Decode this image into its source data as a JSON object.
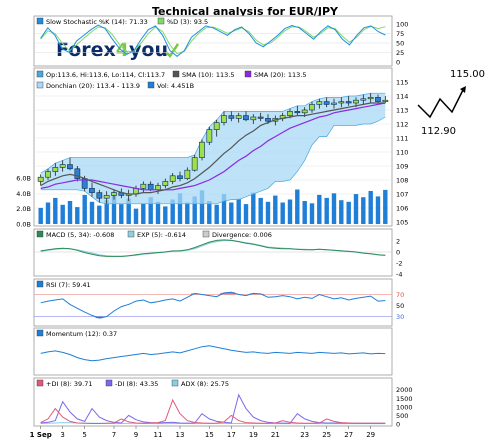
{
  "title": "Technical analysis for EUR/JPY",
  "logo": {
    "text_a": "Forex",
    "digit": "4",
    "text_b": "you"
  },
  "colors": {
    "candle_up": "#2f7fd0",
    "candle_down": "#0b2b55",
    "candle_body_up": "#9fe04a",
    "sma10": "#555555",
    "sma20": "#8a2be2",
    "donchian_fill": "#a8d8f5",
    "volume": "#1f7fd6",
    "macd": "#2e8b57",
    "ema": "#8fd0e0",
    "rsi": "#1f7fd6",
    "momentum": "#1f7fd6",
    "pdi": "#e05a7a",
    "mdi": "#7b68ee",
    "adx": "#87ceeb",
    "stoch_k": "#1f8fe0",
    "stoch_d": "#7ed96a",
    "prediction": "#000000"
  },
  "prediction": {
    "high_label": "115.00",
    "low_label": "112.90"
  },
  "chart_data": [
    {
      "type": "line",
      "panel": "stochastic",
      "legend": [
        "Slow Stochastic %K (14): 71.33",
        "%D (3): 93.5"
      ],
      "y_ticks": [
        "100",
        "75",
        "50",
        "25",
        "0"
      ],
      "ylim": [
        0,
        100
      ],
      "series": [
        {
          "name": "%K",
          "values": [
            62,
            90,
            70,
            35,
            25,
            55,
            70,
            85,
            97,
            88,
            60,
            35,
            20,
            30,
            60,
            85,
            95,
            70,
            30,
            15,
            30,
            65,
            80,
            95,
            90,
            80,
            70,
            85,
            92,
            75,
            50,
            40,
            55,
            70,
            88,
            96,
            90,
            75,
            60,
            80,
            95,
            85,
            60,
            45,
            70,
            90,
            95,
            80,
            71
          ]
        },
        {
          "name": "%D",
          "values": [
            60,
            82,
            75,
            50,
            30,
            45,
            62,
            78,
            92,
            90,
            72,
            45,
            28,
            28,
            50,
            75,
            92,
            80,
            45,
            22,
            28,
            55,
            75,
            90,
            92,
            85,
            75,
            82,
            90,
            80,
            58,
            45,
            50,
            65,
            82,
            93,
            92,
            80,
            65,
            75,
            90,
            88,
            68,
            52,
            65,
            85,
            94,
            88,
            93
          ]
        }
      ]
    },
    {
      "type": "candlestick",
      "panel": "price",
      "legend": [
        "Op:113.6, Hi:113.6, Lo:114, Cl:113.7",
        "SMA (10): 113.5",
        "SMA (20): 113.5",
        "Donchian (20): 113.4 - 113.9",
        "Vol: 4.451B"
      ],
      "y_ticks": [
        "115",
        "114",
        "113",
        "112",
        "111",
        "110",
        "109",
        "108",
        "107",
        "106",
        "105"
      ],
      "ylim": [
        105,
        115
      ],
      "volume_ticks": [
        "6.0B",
        "4.0B",
        "2.0B",
        "0.0B"
      ],
      "volume_ylim": [
        0,
        6
      ],
      "x_ticks": [
        "1 Sep",
        "3",
        "5",
        "7",
        "9",
        "11",
        "13",
        "15",
        "17",
        "19",
        "21",
        "23",
        "25",
        "27",
        "29"
      ],
      "ohlc": [
        [
          107.9,
          108.4,
          107.6,
          108.2
        ],
        [
          108.2,
          108.8,
          108.0,
          108.6
        ],
        [
          108.6,
          109.2,
          108.3,
          108.9
        ],
        [
          108.9,
          109.4,
          108.6,
          109.1
        ],
        [
          109.1,
          109.6,
          108.7,
          108.8
        ],
        [
          108.8,
          109.0,
          107.9,
          108.1
        ],
        [
          108.1,
          108.3,
          107.2,
          107.4
        ],
        [
          107.4,
          107.8,
          106.8,
          107.1
        ],
        [
          107.1,
          107.3,
          106.4,
          106.7
        ],
        [
          106.7,
          107.2,
          106.3,
          106.9
        ],
        [
          106.9,
          107.3,
          106.6,
          107.1
        ],
        [
          107.1,
          107.4,
          106.7,
          106.9
        ],
        [
          106.9,
          107.3,
          106.5,
          107.0
        ],
        [
          107.0,
          107.6,
          106.8,
          107.4
        ],
        [
          107.4,
          107.9,
          107.1,
          107.7
        ],
        [
          107.7,
          107.9,
          107.2,
          107.3
        ],
        [
          107.3,
          107.8,
          107.0,
          107.6
        ],
        [
          107.6,
          108.1,
          107.4,
          107.9
        ],
        [
          107.9,
          108.5,
          107.7,
          108.3
        ],
        [
          108.3,
          108.6,
          107.9,
          108.1
        ],
        [
          108.1,
          108.9,
          108.0,
          108.7
        ],
        [
          108.7,
          109.8,
          108.6,
          109.6
        ],
        [
          109.6,
          110.9,
          109.4,
          110.7
        ],
        [
          110.7,
          111.8,
          110.5,
          111.6
        ],
        [
          111.6,
          112.3,
          111.1,
          112.1
        ],
        [
          112.1,
          112.9,
          111.9,
          112.6
        ],
        [
          112.6,
          112.9,
          112.2,
          112.4
        ],
        [
          112.4,
          112.8,
          112.1,
          112.6
        ],
        [
          112.6,
          112.9,
          112.2,
          112.3
        ],
        [
          112.3,
          112.7,
          112.0,
          112.5
        ],
        [
          112.5,
          112.8,
          112.2,
          112.4
        ],
        [
          112.4,
          112.7,
          112.0,
          112.2
        ],
        [
          112.2,
          112.6,
          111.9,
          112.4
        ],
        [
          112.4,
          112.8,
          112.2,
          112.6
        ],
        [
          112.6,
          113.1,
          112.4,
          112.9
        ],
        [
          112.9,
          113.3,
          112.6,
          112.8
        ],
        [
          112.8,
          113.2,
          112.5,
          113.0
        ],
        [
          113.0,
          113.6,
          112.8,
          113.4
        ],
        [
          113.4,
          113.8,
          113.1,
          113.6
        ],
        [
          113.6,
          113.9,
          113.2,
          113.4
        ],
        [
          113.4,
          113.8,
          113.1,
          113.5
        ],
        [
          113.5,
          113.9,
          113.2,
          113.6
        ],
        [
          113.6,
          114.0,
          113.3,
          113.5
        ],
        [
          113.5,
          113.9,
          113.2,
          113.7
        ],
        [
          113.7,
          114.1,
          113.4,
          113.8
        ],
        [
          113.8,
          114.2,
          113.5,
          113.9
        ],
        [
          113.9,
          114.1,
          113.5,
          113.6
        ],
        [
          113.6,
          114.0,
          113.5,
          113.7
        ]
      ],
      "sma10": [
        107.6,
        107.9,
        108.1,
        108.3,
        108.4,
        108.3,
        108.1,
        107.9,
        107.7,
        107.5,
        107.3,
        107.1,
        107.0,
        107.0,
        107.1,
        107.1,
        107.2,
        107.3,
        107.5,
        107.6,
        107.8,
        108.1,
        108.5,
        108.9,
        109.4,
        109.9,
        110.3,
        110.8,
        111.2,
        111.5,
        111.9,
        112.1,
        112.3,
        112.4,
        112.5,
        112.6,
        112.6,
        112.7,
        112.8,
        112.9,
        113.0,
        113.1,
        113.2,
        113.3,
        113.4,
        113.5,
        113.5,
        113.5
      ],
      "sma20": [
        107.4,
        107.5,
        107.7,
        107.8,
        107.9,
        108.0,
        108.0,
        108.0,
        107.9,
        107.8,
        107.7,
        107.6,
        107.5,
        107.4,
        107.3,
        107.3,
        107.3,
        107.3,
        107.3,
        107.4,
        107.5,
        107.6,
        107.8,
        108.0,
        108.3,
        108.6,
        109.0,
        109.4,
        109.7,
        110.1,
        110.4,
        110.8,
        111.1,
        111.4,
        111.7,
        111.9,
        112.1,
        112.3,
        112.5,
        112.6,
        112.8,
        112.9,
        113.0,
        113.1,
        113.2,
        113.3,
        113.4,
        113.5
      ],
      "donchian_upper": [
        108.5,
        108.8,
        109.2,
        109.4,
        109.6,
        109.6,
        109.6,
        109.6,
        109.6,
        109.6,
        109.6,
        109.6,
        109.6,
        109.6,
        109.6,
        109.6,
        109.6,
        109.6,
        109.6,
        109.6,
        109.6,
        109.8,
        110.9,
        111.8,
        112.3,
        112.9,
        112.9,
        112.9,
        112.9,
        112.9,
        112.9,
        112.9,
        112.9,
        112.9,
        113.1,
        113.3,
        113.3,
        113.6,
        113.8,
        113.9,
        113.9,
        113.9,
        114.0,
        114.0,
        114.1,
        114.2,
        114.2,
        114.2
      ],
      "donchian_lower": [
        107.3,
        107.3,
        107.3,
        107.3,
        107.3,
        107.3,
        107.2,
        106.8,
        106.4,
        106.3,
        106.3,
        106.3,
        106.3,
        106.3,
        106.3,
        106.3,
        106.3,
        106.3,
        106.3,
        106.3,
        106.3,
        106.3,
        106.3,
        106.3,
        106.3,
        106.5,
        106.6,
        106.6,
        106.8,
        107.0,
        107.2,
        107.4,
        107.9,
        107.9,
        108.0,
        108.6,
        109.4,
        110.5,
        111.1,
        111.1,
        111.9,
        111.9,
        111.9,
        111.9,
        112.0,
        112.0,
        112.2,
        112.5
      ],
      "volume": [
        2.1,
        2.8,
        3.4,
        2.5,
        3.0,
        2.2,
        3.8,
        2.9,
        2.4,
        3.1,
        4.2,
        2.6,
        3.3,
        2.0,
        2.7,
        3.5,
        2.9,
        2.3,
        3.2,
        4.0,
        2.8,
        3.6,
        4.4,
        3.0,
        2.5,
        3.9,
        2.8,
        3.3,
        2.6,
        4.1,
        3.4,
        2.9,
        3.7,
        2.8,
        3.2,
        4.5,
        3.0,
        2.7,
        3.8,
        3.4,
        4.0,
        3.1,
        2.9,
        3.9,
        3.5,
        4.3,
        3.6,
        4.45
      ]
    },
    {
      "type": "line",
      "panel": "macd",
      "legend": [
        "MACD (5, 34): -0.608",
        "EXP (5): -0.614",
        "Divergence: 0.006"
      ],
      "y_ticks": [
        "2",
        "0",
        "-2",
        "-4"
      ],
      "ylim": [
        -4,
        2
      ],
      "series": [
        {
          "name": "MACD (5, 34)",
          "values": [
            0.2,
            0.4,
            0.6,
            0.7,
            0.6,
            0.3,
            -0.1,
            -0.4,
            -0.7,
            -0.8,
            -0.8,
            -0.8,
            -0.7,
            -0.5,
            -0.3,
            -0.2,
            -0.1,
            0.0,
            0.2,
            0.2,
            0.4,
            0.8,
            1.3,
            1.8,
            2.1,
            2.2,
            2.1,
            1.9,
            1.6,
            1.4,
            1.1,
            0.8,
            0.7,
            0.6,
            0.6,
            0.5,
            0.4,
            0.4,
            0.5,
            0.4,
            0.3,
            0.2,
            0.1,
            0.0,
            -0.2,
            -0.3,
            -0.5,
            -0.6
          ]
        },
        {
          "name": "EXP (5)",
          "values": [
            0.1,
            0.3,
            0.5,
            0.6,
            0.6,
            0.4,
            0.1,
            -0.2,
            -0.5,
            -0.7,
            -0.8,
            -0.8,
            -0.7,
            -0.6,
            -0.4,
            -0.3,
            -0.1,
            0.0,
            0.1,
            0.2,
            0.3,
            0.6,
            1.1,
            1.6,
            1.9,
            2.1,
            2.1,
            1.9,
            1.7,
            1.5,
            1.2,
            0.9,
            0.8,
            0.7,
            0.6,
            0.5,
            0.5,
            0.4,
            0.5,
            0.4,
            0.3,
            0.2,
            0.1,
            0.0,
            -0.2,
            -0.3,
            -0.5,
            -0.61
          ]
        }
      ]
    },
    {
      "type": "line",
      "panel": "rsi",
      "legend": [
        "RSI (7): 59.41"
      ],
      "y_ticks": [
        "70",
        "50",
        "30"
      ],
      "ylim": [
        20,
        80
      ],
      "series": [
        {
          "name": "RSI (7)",
          "values": [
            55,
            58,
            60,
            62,
            52,
            45,
            38,
            32,
            27,
            30,
            40,
            48,
            52,
            58,
            60,
            55,
            57,
            60,
            62,
            58,
            65,
            72,
            70,
            68,
            66,
            73,
            74,
            70,
            68,
            72,
            71,
            65,
            66,
            68,
            66,
            62,
            65,
            63,
            70,
            66,
            62,
            64,
            60,
            63,
            65,
            67,
            58,
            59
          ]
        }
      ]
    },
    {
      "type": "line",
      "panel": "momentum",
      "legend": [
        "Momentum (12): 0.37"
      ],
      "ylim": [
        -3,
        3
      ],
      "series": [
        {
          "name": "Momentum (12)",
          "values": [
            0.4,
            0.7,
            0.9,
            0.6,
            0.2,
            -0.4,
            -0.8,
            -1.0,
            -0.9,
            -0.6,
            -0.4,
            -0.2,
            0.0,
            0.2,
            0.4,
            0.2,
            0.3,
            0.5,
            0.7,
            0.5,
            0.9,
            1.3,
            1.7,
            1.9,
            1.6,
            1.3,
            1.0,
            0.8,
            0.6,
            0.7,
            0.5,
            0.4,
            0.6,
            0.5,
            0.4,
            0.6,
            0.5,
            0.4,
            0.6,
            0.5,
            0.4,
            0.5,
            0.3,
            0.4,
            0.5,
            0.3,
            0.4,
            0.37
          ]
        }
      ]
    },
    {
      "type": "line",
      "panel": "adx",
      "legend": [
        "+DI (8): 39.71",
        "-DI (8): 43.35",
        "ADX (8): 25.75"
      ],
      "y_ticks": [
        "2000",
        "1500",
        "1000",
        "500",
        "0"
      ],
      "ylim": [
        0,
        2100
      ],
      "series": [
        {
          "name": "+DI (8)",
          "values": [
            80,
            300,
            900,
            400,
            150,
            60,
            40,
            30,
            30,
            40,
            60,
            300,
            120,
            60,
            40,
            60,
            80,
            200,
            1400,
            600,
            200,
            90,
            60,
            40,
            50,
            120,
            500,
            200,
            80,
            60,
            40,
            40,
            60,
            200,
            100,
            60,
            40,
            40,
            60,
            300,
            150,
            80,
            60,
            40,
            40,
            40,
            40,
            40
          ]
        },
        {
          "name": "-DI (8)",
          "values": [
            60,
            100,
            200,
            1300,
            700,
            300,
            150,
            900,
            400,
            200,
            100,
            60,
            500,
            250,
            120,
            80,
            60,
            80,
            100,
            60,
            50,
            60,
            600,
            300,
            150,
            100,
            60,
            1700,
            900,
            400,
            200,
            100,
            60,
            50,
            40,
            600,
            300,
            150,
            80,
            60,
            60,
            50,
            40,
            40,
            40,
            40,
            40,
            43
          ]
        },
        {
          "name": "ADX (8)",
          "values": [
            30,
            40,
            60,
            80,
            70,
            60,
            50,
            45,
            40,
            35,
            30,
            30,
            35,
            35,
            30,
            28,
            26,
            26,
            28,
            30,
            32,
            30,
            28,
            30,
            32,
            30,
            28,
            30,
            35,
            32,
            30,
            28,
            26,
            25,
            25,
            26,
            28,
            27,
            26,
            25,
            25,
            26,
            27,
            26,
            25,
            25,
            26,
            26
          ]
        }
      ]
    }
  ]
}
